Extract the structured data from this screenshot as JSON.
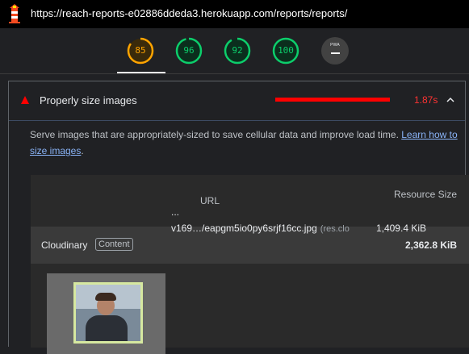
{
  "browser": {
    "url": "https://reach-reports-e02886ddeda3.herokuapp.com/reports/reports/",
    "logo_icon": "lighthouse-icon"
  },
  "scores": [
    {
      "label": "85",
      "value": 85,
      "color": "#ffa400"
    },
    {
      "label": "96",
      "value": 96,
      "color": "#0cce6b"
    },
    {
      "label": "92",
      "value": 92,
      "color": "#0cce6b"
    },
    {
      "label": "100",
      "value": 100,
      "color": "#0cce6b"
    }
  ],
  "pwa": {
    "label": "PWA",
    "icon": "dash-icon"
  },
  "audit": {
    "title": "Properly size images",
    "savings": "1.87s",
    "savings_color": "#ff0000",
    "status_icon": "fail-triangle-icon",
    "expand_icon": "chevron-up-icon",
    "description_text": "Serve images that are appropriately-sized to save cellular data and improve load time. ",
    "learn_more": "Learn how to size images",
    "description_end": "."
  },
  "table": {
    "columns": {
      "url": "URL",
      "resource_size": "Resource Size"
    },
    "group": {
      "name": "Cloudinary",
      "tag": "Content",
      "total": "2,362.8 KiB"
    },
    "rows": [
      {
        "thumbnail_icon": "image-thumbnail",
        "dots": "...",
        "url": "v169…/eapgm5io0py6srjf16cc.jpg",
        "host": "(res.clo",
        "size": "1,409.4 KiB"
      }
    ]
  }
}
